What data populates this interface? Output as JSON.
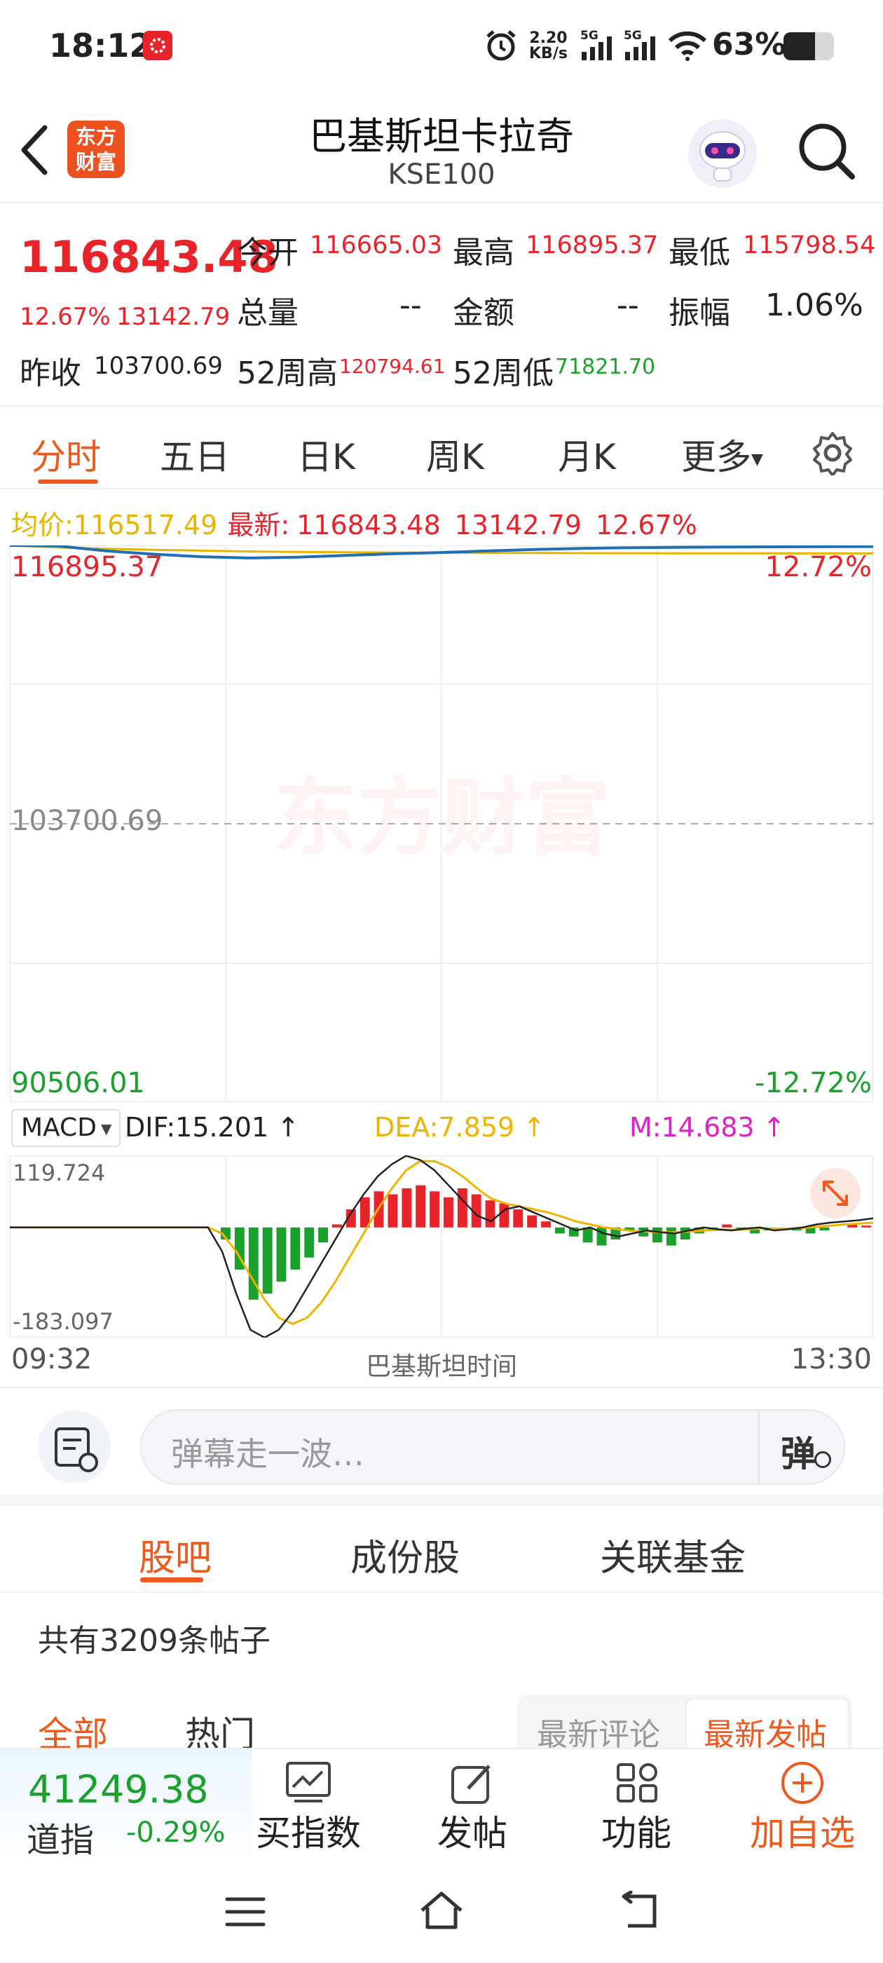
{
  "status_bar": {
    "time": "18:12",
    "net_speed_value": "2.20",
    "net_speed_unit": "KB/s",
    "signal1": "5G",
    "signal2": "5G",
    "battery": "63%"
  },
  "header": {
    "logo_line1": "东方",
    "logo_line2": "财富",
    "title": "巴基斯坦卡拉奇",
    "subtitle": "KSE100"
  },
  "quote": {
    "price": "116843.48",
    "change_pct": "12.67%",
    "change_abs": "13142.79",
    "open_label": "今开",
    "open": "116665.03",
    "high_label": "最高",
    "high": "116895.37",
    "low_label": "最低",
    "low": "115798.54",
    "volume_label": "总量",
    "volume": "--",
    "amount_label": "金额",
    "amount": "--",
    "amplitude_label": "振幅",
    "amplitude": "1.06%",
    "prev_close_label": "昨收",
    "prev_close": "103700.69",
    "w52_high_label": "52周高",
    "w52_high": "120794.61",
    "w52_low_label": "52周低",
    "w52_low": "71821.70"
  },
  "tabs": [
    "分时",
    "五日",
    "日K",
    "周K",
    "月K",
    "更多"
  ],
  "chart_info": {
    "avg_label": "均价:",
    "avg": "116517.49",
    "latest_label": "最新:",
    "latest": "116843.48",
    "latest_chg": "13142.79",
    "latest_pct": "12.67%",
    "y_top": "116895.37",
    "y_top_pct": "12.72%",
    "y_mid": "103700.69",
    "y_bottom": "90506.01",
    "y_bottom_pct": "-12.72%",
    "watermark": "东方财富"
  },
  "macd_info": {
    "selector": "MACD",
    "dif": "DIF:15.201",
    "dea": "DEA:7.859",
    "m": "M:14.683",
    "y_top": "119.724",
    "y_bottom": "-183.097",
    "x_start": "09:32",
    "x_mid": "巴基斯坦时间",
    "x_end": "13:30"
  },
  "chart_data": {
    "type": "line",
    "price_panel": {
      "ylim": [
        90506.01,
        116895.37
      ],
      "baseline": 103700.69,
      "x_range": [
        "09:32",
        "13:30"
      ],
      "series": [
        {
          "name": "最新",
          "color": "#1e6fb5",
          "values": [
            116895,
            116870,
            116640,
            116480,
            116360,
            116300,
            116340,
            116420,
            116500,
            116560,
            116640,
            116710,
            116760,
            116790,
            116810,
            116820,
            116830,
            116840,
            116843
          ]
        },
        {
          "name": "均价",
          "color": "#e8b400",
          "values": [
            116895,
            116800,
            116740,
            116690,
            116650,
            116610,
            116590,
            116570,
            116560,
            116550,
            116540,
            116535,
            116530,
            116525,
            116522,
            116520,
            116519,
            116518,
            116517
          ]
        }
      ]
    },
    "macd_panel": {
      "ylim": [
        -183.097,
        119.724
      ],
      "histogram": [
        0,
        0,
        0,
        0,
        0,
        0,
        0,
        0,
        0,
        0,
        0,
        0,
        0,
        0,
        0,
        -20,
        -70,
        -120,
        -110,
        -90,
        -70,
        -50,
        -25,
        5,
        30,
        50,
        60,
        55,
        65,
        70,
        60,
        50,
        65,
        55,
        45,
        40,
        30,
        20,
        10,
        -10,
        -15,
        -25,
        -30,
        -20,
        -5,
        -15,
        -25,
        -30,
        -20,
        -10,
        -5,
        5,
        -5,
        -10,
        -5,
        0,
        -5,
        -10,
        -5,
        0,
        5,
        3
      ],
      "dif": [
        0,
        0,
        0,
        0,
        0,
        0,
        0,
        0,
        0,
        0,
        0,
        0,
        0,
        0,
        0,
        -40,
        -110,
        -170,
        -183,
        -170,
        -140,
        -100,
        -60,
        -20,
        20,
        55,
        85,
        105,
        119,
        112,
        95,
        70,
        45,
        20,
        10,
        30,
        35,
        25,
        15,
        5,
        -5,
        0,
        -10,
        -15,
        -10,
        -5,
        -8,
        -10,
        -5,
        0,
        -3,
        -5,
        -2,
        0,
        -5,
        -3,
        0,
        5,
        8,
        10,
        12,
        15.2
      ],
      "dea": [
        0,
        0,
        0,
        0,
        0,
        0,
        0,
        0,
        0,
        0,
        0,
        0,
        0,
        0,
        0,
        -10,
        -40,
        -80,
        -120,
        -150,
        -160,
        -150,
        -125,
        -90,
        -50,
        -10,
        30,
        65,
        95,
        110,
        110,
        100,
        85,
        65,
        48,
        40,
        35,
        30,
        25,
        18,
        10,
        5,
        0,
        -3,
        -6,
        -7,
        -8,
        -8,
        -7,
        -5,
        -4,
        -4,
        -3,
        -2,
        -2,
        -2,
        -1,
        1,
        3,
        5,
        6.5,
        7.859
      ]
    }
  },
  "comment_bar": {
    "placeholder": "弹幕走一波…",
    "danmu_label": "弹"
  },
  "forum": {
    "tabs": [
      "股吧",
      "成份股",
      "关联基金"
    ],
    "post_count": "共有3209条帖子",
    "filters": [
      "全部",
      "热门"
    ],
    "sort_options": [
      "最新评论",
      "最新发帖"
    ]
  },
  "bottom_bar": {
    "index_value": "41249.38",
    "index_name": "道指",
    "index_change": "-0.29%",
    "buttons": [
      "买指数",
      "发帖",
      "功能",
      "加自选"
    ]
  },
  "colors": {
    "accent": "#ec5a1e",
    "up": "#e8242a",
    "down": "#1aa12c",
    "price_line": "#1e6fb5",
    "avg_line": "#e8b400",
    "dea_line": "#f0b400",
    "m_text": "#e020c8"
  }
}
